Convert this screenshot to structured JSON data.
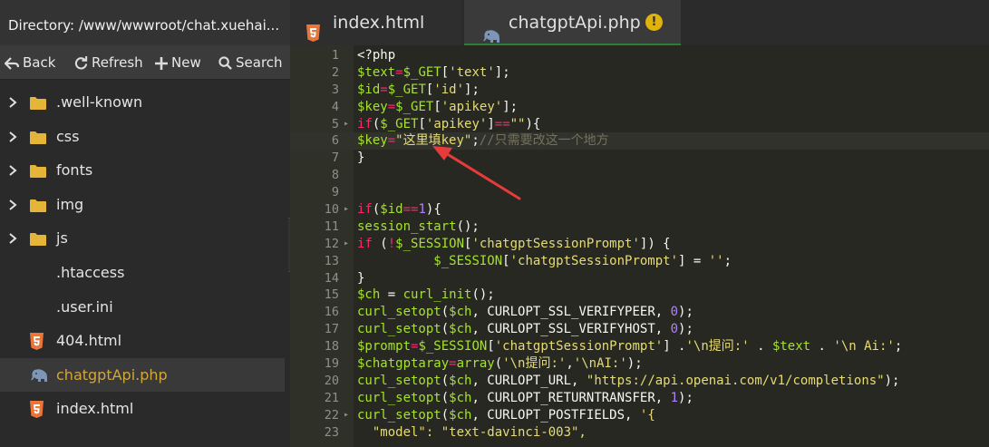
{
  "sidebar": {
    "directory_label": "Directory: /www/wwwroot/chat.xuehai...",
    "toolbar": [
      {
        "label": "Back",
        "icon": "back-arrow-icon"
      },
      {
        "label": "Refresh",
        "icon": "refresh-icon"
      },
      {
        "label": "New",
        "icon": "plus-icon"
      },
      {
        "label": "Search",
        "icon": "search-icon"
      }
    ],
    "tree": [
      {
        "label": ".well-known",
        "type": "folder"
      },
      {
        "label": "css",
        "type": "folder"
      },
      {
        "label": "fonts",
        "type": "folder"
      },
      {
        "label": "img",
        "type": "folder"
      },
      {
        "label": "js",
        "type": "folder"
      },
      {
        "label": ".htaccess",
        "type": "file"
      },
      {
        "label": ".user.ini",
        "type": "file"
      },
      {
        "label": "404.html",
        "type": "html"
      },
      {
        "label": "chatgptApi.php",
        "type": "php",
        "active": true
      },
      {
        "label": "index.html",
        "type": "html"
      }
    ]
  },
  "tabs": [
    {
      "label": "index.html",
      "icon": "html5-icon"
    },
    {
      "label": "chatgptApi.php",
      "icon": "php-elephant-icon",
      "active": true,
      "modified": true
    }
  ],
  "modified_marker": "!",
  "colors": {
    "folder": "#e5b539",
    "html_icon": "#e8753a",
    "php_icon": "#7d96b8",
    "active_file": "#d4a63a",
    "modified_badge": "#e0b30c",
    "arrow": "#e53b3b"
  },
  "editor": {
    "current_line": 6,
    "lines": [
      {
        "n": "1",
        "fold": "",
        "tokens": [
          [
            "t",
            "<?php"
          ]
        ]
      },
      {
        "n": "2",
        "fold": "",
        "tokens": [
          [
            "v",
            "$text"
          ],
          [
            "k",
            "="
          ],
          [
            "v",
            "$_GET"
          ],
          [
            "t",
            "["
          ],
          [
            "s",
            "'text'"
          ],
          [
            "t",
            "];"
          ]
        ]
      },
      {
        "n": "3",
        "fold": "",
        "tokens": [
          [
            "v",
            "$id"
          ],
          [
            "k",
            "="
          ],
          [
            "v",
            "$_GET"
          ],
          [
            "t",
            "["
          ],
          [
            "s",
            "'id'"
          ],
          [
            "t",
            "];"
          ]
        ]
      },
      {
        "n": "4",
        "fold": "",
        "tokens": [
          [
            "v",
            "$key"
          ],
          [
            "k",
            "="
          ],
          [
            "v",
            "$_GET"
          ],
          [
            "t",
            "["
          ],
          [
            "s",
            "'apikey'"
          ],
          [
            "t",
            "];"
          ]
        ]
      },
      {
        "n": "5",
        "fold": "▸",
        "tokens": [
          [
            "k",
            "if"
          ],
          [
            "t",
            "("
          ],
          [
            "v",
            "$_GET"
          ],
          [
            "t",
            "["
          ],
          [
            "s",
            "'apikey'"
          ],
          [
            "t",
            "]"
          ],
          [
            "k",
            "=="
          ],
          [
            "s",
            "\"\""
          ],
          [
            "t",
            "){"
          ]
        ]
      },
      {
        "n": "6",
        "fold": "",
        "tokens": [
          [
            "v",
            "$key"
          ],
          [
            "k",
            "="
          ],
          [
            "s",
            "\"这里填key\""
          ],
          [
            "t",
            ";"
          ],
          [
            "c",
            "//只需要改这一个地方"
          ]
        ]
      },
      {
        "n": "7",
        "fold": "",
        "tokens": [
          [
            "t",
            "}"
          ]
        ]
      },
      {
        "n": "8",
        "fold": "",
        "tokens": []
      },
      {
        "n": "9",
        "fold": "",
        "tokens": []
      },
      {
        "n": "10",
        "fold": "▸",
        "tokens": [
          [
            "k",
            "if"
          ],
          [
            "t",
            "("
          ],
          [
            "v",
            "$id"
          ],
          [
            "k",
            "=="
          ],
          [
            "n",
            "1"
          ],
          [
            "t",
            "){"
          ]
        ]
      },
      {
        "n": "11",
        "fold": "",
        "tokens": [
          [
            "v",
            "session_start"
          ],
          [
            "t",
            "();"
          ]
        ]
      },
      {
        "n": "12",
        "fold": "▸",
        "tokens": [
          [
            "k",
            "if"
          ],
          [
            "t",
            " ("
          ],
          [
            "k",
            "!"
          ],
          [
            "v",
            "$_SESSION"
          ],
          [
            "t",
            "["
          ],
          [
            "s",
            "'chatgptSessionPrompt'"
          ],
          [
            "t",
            "]) {"
          ]
        ]
      },
      {
        "n": "13",
        "fold": "",
        "tokens": [
          [
            "t",
            "          "
          ],
          [
            "v",
            "$_SESSION"
          ],
          [
            "t",
            "["
          ],
          [
            "s",
            "'chatgptSessionPrompt'"
          ],
          [
            "t",
            "] = "
          ],
          [
            "s",
            "''"
          ],
          [
            "t",
            ";"
          ]
        ]
      },
      {
        "n": "14",
        "fold": "",
        "tokens": [
          [
            "t",
            "}"
          ]
        ]
      },
      {
        "n": "15",
        "fold": "",
        "tokens": [
          [
            "v",
            "$ch"
          ],
          [
            "t",
            " = "
          ],
          [
            "v",
            "curl_init"
          ],
          [
            "t",
            "();"
          ]
        ]
      },
      {
        "n": "16",
        "fold": "",
        "tokens": [
          [
            "v",
            "curl_setopt"
          ],
          [
            "t",
            "("
          ],
          [
            "v",
            "$ch"
          ],
          [
            "t",
            ", CURLOPT_SSL_VERIFYPEER, "
          ],
          [
            "n",
            "0"
          ],
          [
            "t",
            ");"
          ]
        ]
      },
      {
        "n": "17",
        "fold": "",
        "tokens": [
          [
            "v",
            "curl_setopt"
          ],
          [
            "t",
            "("
          ],
          [
            "v",
            "$ch"
          ],
          [
            "t",
            ", CURLOPT_SSL_VERIFYHOST, "
          ],
          [
            "n",
            "0"
          ],
          [
            "t",
            ");"
          ]
        ]
      },
      {
        "n": "18",
        "fold": "",
        "tokens": [
          [
            "v",
            "$prompt"
          ],
          [
            "k",
            "="
          ],
          [
            "v",
            "$_SESSION"
          ],
          [
            "t",
            "["
          ],
          [
            "s",
            "'chatgptSessionPrompt'"
          ],
          [
            "t",
            "] ."
          ],
          [
            "s",
            "'\\n提问:'"
          ],
          [
            "t",
            " . "
          ],
          [
            "v",
            "$text"
          ],
          [
            "t",
            " . "
          ],
          [
            "s",
            "'\\n Ai:'"
          ],
          [
            "t",
            ";"
          ]
        ]
      },
      {
        "n": "19",
        "fold": "",
        "tokens": [
          [
            "v",
            "$chatgptaray"
          ],
          [
            "k",
            "="
          ],
          [
            "v",
            "array"
          ],
          [
            "t",
            "("
          ],
          [
            "s",
            "'\\n提问:'"
          ],
          [
            "t",
            ","
          ],
          [
            "s",
            "'\\nAI:'"
          ],
          [
            "t",
            ");"
          ]
        ]
      },
      {
        "n": "20",
        "fold": "",
        "tokens": [
          [
            "v",
            "curl_setopt"
          ],
          [
            "t",
            "("
          ],
          [
            "v",
            "$ch"
          ],
          [
            "t",
            ", CURLOPT_URL, "
          ],
          [
            "s",
            "\"https://api.openai.com/v1/completions\""
          ],
          [
            "t",
            ");"
          ]
        ]
      },
      {
        "n": "21",
        "fold": "",
        "tokens": [
          [
            "v",
            "curl_setopt"
          ],
          [
            "t",
            "("
          ],
          [
            "v",
            "$ch"
          ],
          [
            "t",
            ", CURLOPT_RETURNTRANSFER, "
          ],
          [
            "n",
            "1"
          ],
          [
            "t",
            ");"
          ]
        ]
      },
      {
        "n": "22",
        "fold": "▸",
        "tokens": [
          [
            "v",
            "curl_setopt"
          ],
          [
            "t",
            "("
          ],
          [
            "v",
            "$ch"
          ],
          [
            "t",
            ", CURLOPT_POSTFIELDS, "
          ],
          [
            "s",
            "'{"
          ]
        ]
      },
      {
        "n": "23",
        "fold": "",
        "tokens": [
          [
            "s",
            "  \"model\": \"text-davinci-003\","
          ]
        ]
      }
    ]
  }
}
